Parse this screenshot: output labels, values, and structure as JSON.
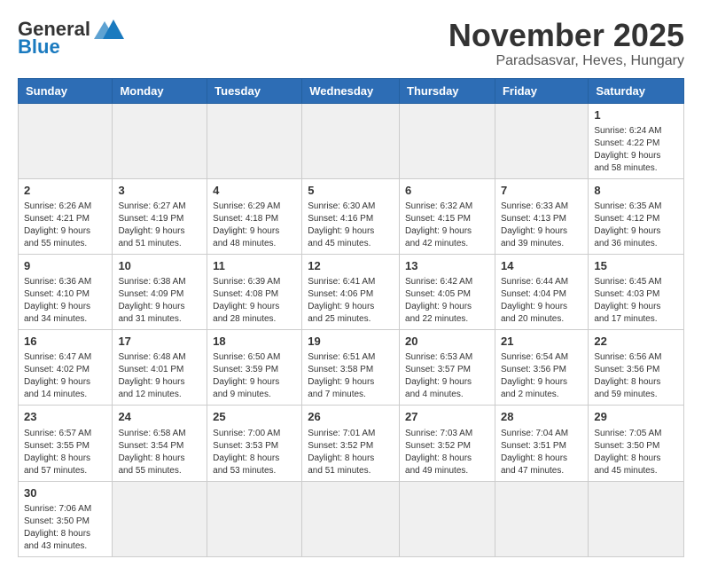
{
  "header": {
    "logo_general": "General",
    "logo_blue": "Blue",
    "month_title": "November 2025",
    "location": "Paradsasvar, Heves, Hungary"
  },
  "weekdays": [
    "Sunday",
    "Monday",
    "Tuesday",
    "Wednesday",
    "Thursday",
    "Friday",
    "Saturday"
  ],
  "weeks": [
    [
      {
        "day": "",
        "info": ""
      },
      {
        "day": "",
        "info": ""
      },
      {
        "day": "",
        "info": ""
      },
      {
        "day": "",
        "info": ""
      },
      {
        "day": "",
        "info": ""
      },
      {
        "day": "",
        "info": ""
      },
      {
        "day": "1",
        "info": "Sunrise: 6:24 AM\nSunset: 4:22 PM\nDaylight: 9 hours\nand 58 minutes."
      }
    ],
    [
      {
        "day": "2",
        "info": "Sunrise: 6:26 AM\nSunset: 4:21 PM\nDaylight: 9 hours\nand 55 minutes."
      },
      {
        "day": "3",
        "info": "Sunrise: 6:27 AM\nSunset: 4:19 PM\nDaylight: 9 hours\nand 51 minutes."
      },
      {
        "day": "4",
        "info": "Sunrise: 6:29 AM\nSunset: 4:18 PM\nDaylight: 9 hours\nand 48 minutes."
      },
      {
        "day": "5",
        "info": "Sunrise: 6:30 AM\nSunset: 4:16 PM\nDaylight: 9 hours\nand 45 minutes."
      },
      {
        "day": "6",
        "info": "Sunrise: 6:32 AM\nSunset: 4:15 PM\nDaylight: 9 hours\nand 42 minutes."
      },
      {
        "day": "7",
        "info": "Sunrise: 6:33 AM\nSunset: 4:13 PM\nDaylight: 9 hours\nand 39 minutes."
      },
      {
        "day": "8",
        "info": "Sunrise: 6:35 AM\nSunset: 4:12 PM\nDaylight: 9 hours\nand 36 minutes."
      }
    ],
    [
      {
        "day": "9",
        "info": "Sunrise: 6:36 AM\nSunset: 4:10 PM\nDaylight: 9 hours\nand 34 minutes."
      },
      {
        "day": "10",
        "info": "Sunrise: 6:38 AM\nSunset: 4:09 PM\nDaylight: 9 hours\nand 31 minutes."
      },
      {
        "day": "11",
        "info": "Sunrise: 6:39 AM\nSunset: 4:08 PM\nDaylight: 9 hours\nand 28 minutes."
      },
      {
        "day": "12",
        "info": "Sunrise: 6:41 AM\nSunset: 4:06 PM\nDaylight: 9 hours\nand 25 minutes."
      },
      {
        "day": "13",
        "info": "Sunrise: 6:42 AM\nSunset: 4:05 PM\nDaylight: 9 hours\nand 22 minutes."
      },
      {
        "day": "14",
        "info": "Sunrise: 6:44 AM\nSunset: 4:04 PM\nDaylight: 9 hours\nand 20 minutes."
      },
      {
        "day": "15",
        "info": "Sunrise: 6:45 AM\nSunset: 4:03 PM\nDaylight: 9 hours\nand 17 minutes."
      }
    ],
    [
      {
        "day": "16",
        "info": "Sunrise: 6:47 AM\nSunset: 4:02 PM\nDaylight: 9 hours\nand 14 minutes."
      },
      {
        "day": "17",
        "info": "Sunrise: 6:48 AM\nSunset: 4:01 PM\nDaylight: 9 hours\nand 12 minutes."
      },
      {
        "day": "18",
        "info": "Sunrise: 6:50 AM\nSunset: 3:59 PM\nDaylight: 9 hours\nand 9 minutes."
      },
      {
        "day": "19",
        "info": "Sunrise: 6:51 AM\nSunset: 3:58 PM\nDaylight: 9 hours\nand 7 minutes."
      },
      {
        "day": "20",
        "info": "Sunrise: 6:53 AM\nSunset: 3:57 PM\nDaylight: 9 hours\nand 4 minutes."
      },
      {
        "day": "21",
        "info": "Sunrise: 6:54 AM\nSunset: 3:56 PM\nDaylight: 9 hours\nand 2 minutes."
      },
      {
        "day": "22",
        "info": "Sunrise: 6:56 AM\nSunset: 3:56 PM\nDaylight: 8 hours\nand 59 minutes."
      }
    ],
    [
      {
        "day": "23",
        "info": "Sunrise: 6:57 AM\nSunset: 3:55 PM\nDaylight: 8 hours\nand 57 minutes."
      },
      {
        "day": "24",
        "info": "Sunrise: 6:58 AM\nSunset: 3:54 PM\nDaylight: 8 hours\nand 55 minutes."
      },
      {
        "day": "25",
        "info": "Sunrise: 7:00 AM\nSunset: 3:53 PM\nDaylight: 8 hours\nand 53 minutes."
      },
      {
        "day": "26",
        "info": "Sunrise: 7:01 AM\nSunset: 3:52 PM\nDaylight: 8 hours\nand 51 minutes."
      },
      {
        "day": "27",
        "info": "Sunrise: 7:03 AM\nSunset: 3:52 PM\nDaylight: 8 hours\nand 49 minutes."
      },
      {
        "day": "28",
        "info": "Sunrise: 7:04 AM\nSunset: 3:51 PM\nDaylight: 8 hours\nand 47 minutes."
      },
      {
        "day": "29",
        "info": "Sunrise: 7:05 AM\nSunset: 3:50 PM\nDaylight: 8 hours\nand 45 minutes."
      }
    ],
    [
      {
        "day": "30",
        "info": "Sunrise: 7:06 AM\nSunset: 3:50 PM\nDaylight: 8 hours\nand 43 minutes."
      },
      {
        "day": "",
        "info": ""
      },
      {
        "day": "",
        "info": ""
      },
      {
        "day": "",
        "info": ""
      },
      {
        "day": "",
        "info": ""
      },
      {
        "day": "",
        "info": ""
      },
      {
        "day": "",
        "info": ""
      }
    ]
  ]
}
